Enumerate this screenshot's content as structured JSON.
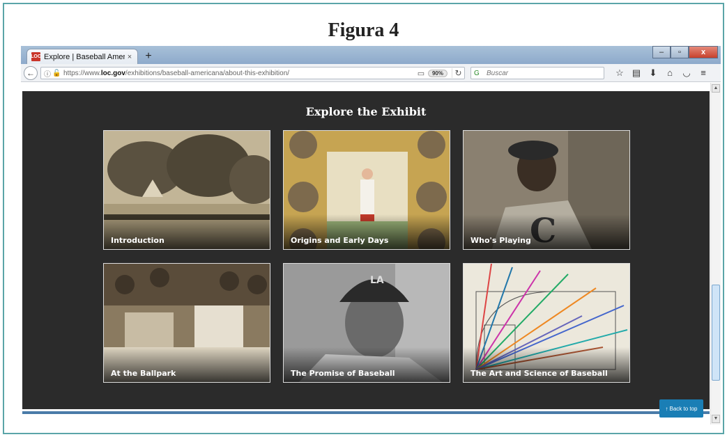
{
  "figure_title": "Figura 4",
  "browser": {
    "tab": {
      "title": "Explore | Baseball America...",
      "favicon": "LOC",
      "close": "×"
    },
    "new_tab": "+",
    "window_controls": {
      "minimize": "–",
      "maximize": "▫",
      "close": "x"
    },
    "back": "←",
    "address": {
      "prefix": "https://www.",
      "domain": "loc.gov",
      "path": "/exhibitions/baseball-americana/about-this-exhibition/"
    },
    "zoom": "90%",
    "reload": "↻",
    "search": {
      "placeholder": "Buscar"
    },
    "toolbar_icons": [
      "star-icon",
      "clipboard-icon",
      "download-icon",
      "home-icon",
      "pocket-icon",
      "menu-icon"
    ]
  },
  "page": {
    "section_title": "Explore the Exhibit",
    "cards": [
      {
        "label": "Introduction"
      },
      {
        "label": "Origins and Early Days"
      },
      {
        "label": "Who's Playing"
      },
      {
        "label": "At the Ballpark"
      },
      {
        "label": "The Promise of Baseball"
      },
      {
        "label": "The Art and Science of Baseball"
      }
    ],
    "back_to_top": "Back to top",
    "back_to_top_icon": "↑"
  },
  "colors": {
    "section_bg": "#2b2b2b",
    "accent_button": "#1a7eb5",
    "frame_border": "#5aa5a8"
  }
}
